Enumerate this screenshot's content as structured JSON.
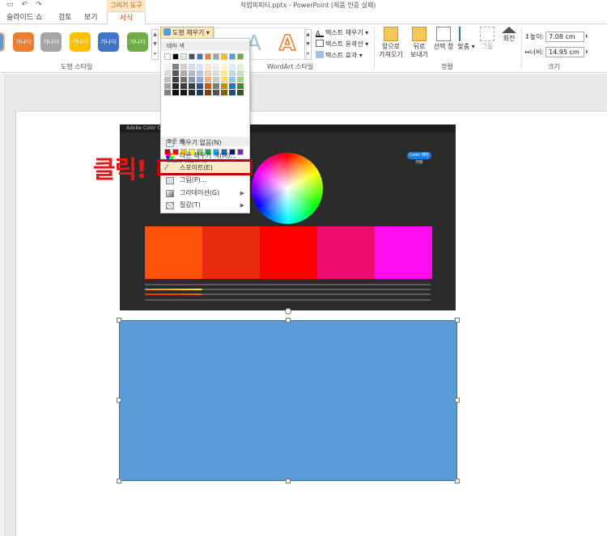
{
  "window": {
    "title": "작업피피티.pptx - PowerPoint (제품 인증 실패)",
    "context_tab_group": "그리기 도구"
  },
  "tabs": [
    {
      "label": "슬라이드 쇼"
    },
    {
      "label": "검토"
    },
    {
      "label": "보기"
    },
    {
      "label": "서식",
      "active": true
    }
  ],
  "ribbon": {
    "shape_styles": {
      "group_label": "도형 스타일",
      "preset_text": "가나다",
      "presets": [
        "#ed7d31",
        "#a5a5a5",
        "#ffc000",
        "#4472c4",
        "#70ad47"
      ]
    },
    "fill_button": {
      "label": "도형 채우기"
    },
    "wordart": {
      "group_label": "WordArt 스타일",
      "letter": "A"
    },
    "text_options": [
      {
        "label": "텍스트 채우기"
      },
      {
        "label": "텍스트 윤곽선"
      },
      {
        "label": "텍스트 효과"
      }
    ],
    "arrange": {
      "group_label": "정렬",
      "items": [
        {
          "line1": "앞으로",
          "line2": "가져오기"
        },
        {
          "line1": "뒤로",
          "line2": "보내기"
        },
        {
          "line1": "선택 창",
          "line2": ""
        },
        {
          "line1": "맞춤",
          "line2": ""
        },
        {
          "line1": "그룹",
          "line2": ""
        },
        {
          "line1": "회전",
          "line2": ""
        }
      ]
    },
    "size": {
      "group_label": "크기",
      "height_label": "높이:",
      "height_value": "7.08 cm",
      "width_label": "너비:",
      "width_value": "14.95 cm"
    }
  },
  "menu": {
    "theme_colors_label": "테마 색",
    "standard_colors_label": "표준 색",
    "recent_colors_label": "최근에 사용한 색",
    "theme_top_row": [
      "#ffffff",
      "#000000",
      "#e7e6e6",
      "#44546a",
      "#4472c4",
      "#ed7d31",
      "#a5a5a5",
      "#ffc000",
      "#5b9bd5",
      "#70ad47"
    ],
    "theme_shades": [
      [
        "#f2f2f2",
        "#d9d9d9",
        "#bfbfbf",
        "#a6a6a6",
        "#808080"
      ],
      [
        "#808080",
        "#595959",
        "#404040",
        "#262626",
        "#0d0d0d"
      ],
      [
        "#d0cece",
        "#aeaaaa",
        "#757171",
        "#3a3838",
        "#171616"
      ],
      [
        "#d6dce4",
        "#adb9ca",
        "#8497b0",
        "#333f4f",
        "#222a35"
      ],
      [
        "#d9e2f3",
        "#b4c6e7",
        "#8eaadb",
        "#2f5496",
        "#1f3864"
      ],
      [
        "#fbe5d5",
        "#f7cbac",
        "#f4b183",
        "#c55a11",
        "#843c0b"
      ],
      [
        "#ededed",
        "#dbdbdb",
        "#c9c9c9",
        "#7b7b7b",
        "#525252"
      ],
      [
        "#fff2cc",
        "#ffe599",
        "#ffd966",
        "#bf9000",
        "#7f6000"
      ],
      [
        "#deebf6",
        "#bdd7ee",
        "#9dc3e6",
        "#2e75b5",
        "#1e4e79"
      ],
      [
        "#e2efd9",
        "#c5e0b3",
        "#a8d08d",
        "#538135",
        "#375623"
      ]
    ],
    "standard_colors": [
      "#c00000",
      "#ff0000",
      "#ffc000",
      "#ffff00",
      "#92d050",
      "#00b050",
      "#00b0f0",
      "#0070c0",
      "#002060",
      "#7030a0"
    ],
    "recent_colors": [
      "#c5d9f1",
      "#daeef3",
      "#dce6f1",
      "#b7dee8",
      "#4f81bd",
      "#e4dfec",
      "#8db3e2",
      "#b1a0c7",
      "#1f497d",
      "#dbe5f1"
    ],
    "items": [
      {
        "label": "채우기 없음(N)"
      },
      {
        "label": "다른 채우기 색(M)..."
      },
      {
        "label": "스포이트(E)"
      },
      {
        "label": "그림(P)..."
      },
      {
        "label": "그라데이션(G)"
      },
      {
        "label": "질감(T)"
      }
    ]
  },
  "annotation": {
    "text": "클릭!"
  },
  "screenshot_image": {
    "app_title": "Adobe Color CC",
    "button_label": "Color 테마 저장",
    "swatches": [
      "#ff5208",
      "#e8290e",
      "#ff0000",
      "#eb0e6e",
      "#ff0cf0"
    ]
  }
}
